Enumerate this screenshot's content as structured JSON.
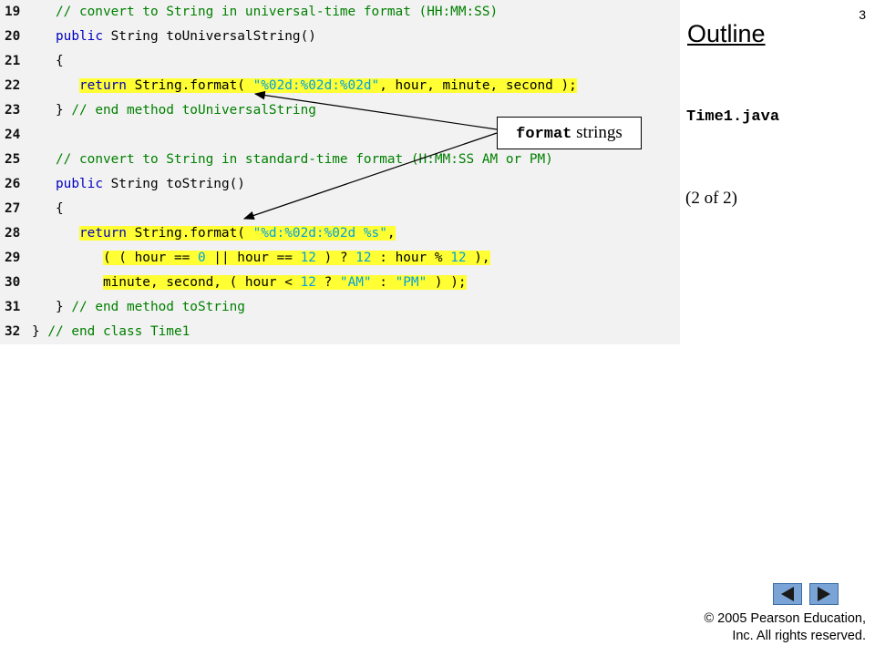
{
  "slide": {
    "number": "3"
  },
  "sidebar": {
    "outline_label": "Outline",
    "filename": "Time1.java",
    "part": "(2 of 2)"
  },
  "callout": {
    "mono": "format",
    "text": " strings"
  },
  "code_lines": [
    {
      "num": "19",
      "text": "   // convert to String in universal-time format (HH:MM:SS)"
    },
    {
      "num": "20",
      "text": "   public String toUniversalString()"
    },
    {
      "num": "21",
      "text": "   {"
    },
    {
      "num": "22",
      "text": "      return String.format( \"%02d:%02d:%02d\", hour, minute, second );"
    },
    {
      "num": "23",
      "text": "   } // end method toUniversalString"
    },
    {
      "num": "24",
      "text": ""
    },
    {
      "num": "25",
      "text": "   // convert to String in standard-time format (H:MM:SS AM or PM)"
    },
    {
      "num": "26",
      "text": "   public String toString()"
    },
    {
      "num": "27",
      "text": "   {"
    },
    {
      "num": "28",
      "text": "      return String.format( \"%d:%02d:%02d %s\","
    },
    {
      "num": "29",
      "text": "         ( ( hour == 0 || hour == 12 ) ? 12 : hour % 12 ),"
    },
    {
      "num": "30",
      "text": "         minute, second, ( hour < 12 ? \"AM\" : \"PM\" ) );"
    },
    {
      "num": "31",
      "text": "   } // end method toString"
    },
    {
      "num": "32",
      "text": "} // end class Time1"
    }
  ],
  "footer": {
    "copyright_line1": "© 2005 Pearson Education,",
    "copyright_line2": "Inc.  All rights reserved."
  },
  "colors": {
    "highlight": "#ffff33",
    "comment": "#008000",
    "keyword": "#0000c0",
    "string": "#00a0e0",
    "code_bg": "#f2f2f2"
  },
  "icons": {
    "prev": "triangle-left-icon",
    "next": "triangle-right-icon"
  }
}
